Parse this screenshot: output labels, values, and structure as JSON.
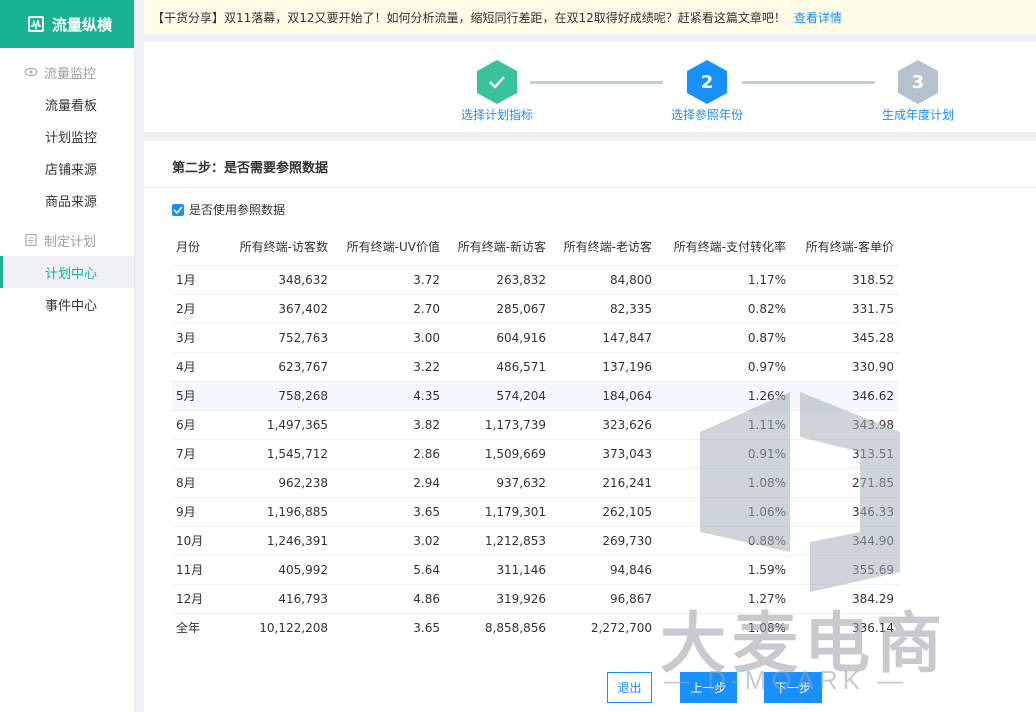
{
  "brand": {
    "name": "流量纵横"
  },
  "sidebar": {
    "groups": [
      {
        "label": "流量监控",
        "items": [
          "流量看板",
          "计划监控",
          "店铺来源",
          "商品来源"
        ]
      },
      {
        "label": "制定计划",
        "items": [
          "计划中心",
          "事件中心"
        ]
      }
    ],
    "active": "计划中心"
  },
  "notice": {
    "text": "【干货分享】双11落幕，双12又要开始了！如何分析流量，缩短同行差距，在双12取得好成绩呢？赶紧看这篇文章吧！",
    "link": "查看详情"
  },
  "steps": [
    {
      "num": "",
      "label": "选择计划指标",
      "state": "done"
    },
    {
      "num": "2",
      "label": "选择参照年份",
      "state": "active"
    },
    {
      "num": "3",
      "label": "生成年度计划",
      "state": "pending"
    }
  ],
  "panel": {
    "title": "第二步：是否需要参照数据",
    "checkbox_label": "是否使用参照数据",
    "checkbox_checked": true
  },
  "table": {
    "headers": [
      "月份",
      "所有终端-访客数",
      "所有终端-UV价值",
      "所有终端-新访客",
      "所有终端-老访客",
      "所有终端-支付转化率",
      "所有终端-客单价"
    ],
    "rows": [
      [
        "1月",
        "348,632",
        "3.72",
        "263,832",
        "84,800",
        "1.17%",
        "318.52"
      ],
      [
        "2月",
        "367,402",
        "2.70",
        "285,067",
        "82,335",
        "0.82%",
        "331.75"
      ],
      [
        "3月",
        "752,763",
        "3.00",
        "604,916",
        "147,847",
        "0.87%",
        "345.28"
      ],
      [
        "4月",
        "623,767",
        "3.22",
        "486,571",
        "137,196",
        "0.97%",
        "330.90"
      ],
      [
        "5月",
        "758,268",
        "4.35",
        "574,204",
        "184,064",
        "1.26%",
        "346.62"
      ],
      [
        "6月",
        "1,497,365",
        "3.82",
        "1,173,739",
        "323,626",
        "1.11%",
        "343.98"
      ],
      [
        "7月",
        "1,545,712",
        "2.86",
        "1,509,669",
        "373,043",
        "0.91%",
        "313.51"
      ],
      [
        "8月",
        "962,238",
        "2.94",
        "937,632",
        "216,241",
        "1.08%",
        "271.85"
      ],
      [
        "9月",
        "1,196,885",
        "3.65",
        "1,179,301",
        "262,105",
        "1.06%",
        "346.33"
      ],
      [
        "10月",
        "1,246,391",
        "3.02",
        "1,212,853",
        "269,730",
        "0.88%",
        "344.90"
      ],
      [
        "11月",
        "405,992",
        "5.64",
        "311,146",
        "94,846",
        "1.59%",
        "355.69"
      ],
      [
        "12月",
        "416,793",
        "4.86",
        "319,926",
        "96,867",
        "1.27%",
        "384.29"
      ],
      [
        "全年",
        "10,122,208",
        "3.65",
        "8,858,856",
        "2,272,700",
        "1.08%",
        "336.14"
      ]
    ],
    "highlighted_row": 4
  },
  "buttons": {
    "exit": "退出",
    "prev": "上一步",
    "next": "下一步"
  },
  "watermark": {
    "text": "大麦电商",
    "sub": "— D-MOARK —"
  },
  "colors": {
    "brand": "#19b394",
    "primary": "#1890ff",
    "done_step": "#3cc29a",
    "pending_step": "#b6c3cf"
  }
}
